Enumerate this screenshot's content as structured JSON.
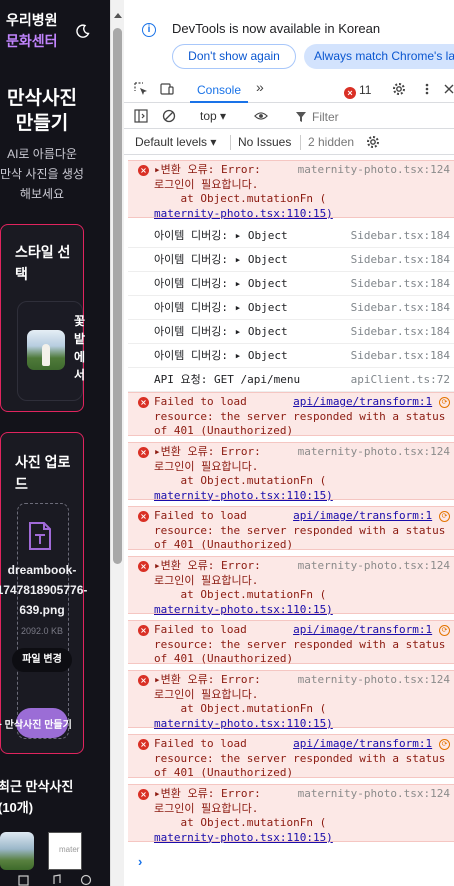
{
  "app": {
    "brand_line1": "우리병원",
    "brand_line2": "문화센터",
    "hero_title": "만삭사진 만들기",
    "hero_subtitle": "AI로 아름다운 만삭 사진을 생성해보세요",
    "style_section": {
      "title": "스타일 선택",
      "item_label": "꽃밭에서"
    },
    "upload_section": {
      "title": "사진 업로드",
      "file_name": "dreambook-1747818905776-639.png",
      "file_size": "2092.0 KB",
      "change_button": "파일 변경"
    },
    "generate_button": "+ 만삭사진 만들기",
    "recent_title": "최근 만삭사진 (10개)",
    "recent_broken_alt": "mater"
  },
  "devtools": {
    "info_text": "DevTools is now available in Korean",
    "dont_show": "Don't show again",
    "always_match": "Always match Chrome's language",
    "tab_console": "Console",
    "error_count": "11",
    "context": "top",
    "filter_placeholder": "Filter",
    "default_levels": "Default levels ▾",
    "no_issues": "No Issues",
    "hidden": "2 hidden",
    "logs": [
      {
        "type": "err",
        "l1": "▸변환 오류: Error:",
        "src": "maternity-photo.tsx:124",
        "l2": "로그인이 필요합니다.",
        "l3": "    at Object.mutationFn (",
        "l4": "maternity-photo.tsx:110:15)"
      },
      {
        "type": "info",
        "msg": "아이템 디버깅: ▸ Object",
        "src": "Sidebar.tsx:184"
      },
      {
        "type": "info",
        "msg": "아이템 디버깅: ▸ Object",
        "src": "Sidebar.tsx:184"
      },
      {
        "type": "info",
        "msg": "아이템 디버깅: ▸ Object",
        "src": "Sidebar.tsx:184"
      },
      {
        "type": "info",
        "msg": "아이템 디버깅: ▸ Object",
        "src": "Sidebar.tsx:184"
      },
      {
        "type": "info",
        "msg": "아이템 디버깅: ▸ Object",
        "src": "Sidebar.tsx:184"
      },
      {
        "type": "info",
        "msg": "아이템 디버깅: ▸ Object",
        "src": "Sidebar.tsx:184"
      },
      {
        "type": "info",
        "msg": "API 요청: GET /api/menu",
        "src": "apiClient.ts:72"
      },
      {
        "type": "err401",
        "l1": "Failed to load",
        "lnk": "api/image/transform:1",
        "l2": "resource: the server responded with a status",
        "l3": "of 401 (Unauthorized)"
      },
      {
        "type": "err",
        "l1": "▸변환 오류: Error:",
        "src": "maternity-photo.tsx:124",
        "l2": "로그인이 필요합니다.",
        "l3": "    at Object.mutationFn (",
        "l4": "maternity-photo.tsx:110:15)"
      },
      {
        "type": "err401",
        "l1": "Failed to load",
        "lnk": "api/image/transform:1",
        "l2": "resource: the server responded with a status",
        "l3": "of 401 (Unauthorized)"
      },
      {
        "type": "err",
        "l1": "▸변환 오류: Error:",
        "src": "maternity-photo.tsx:124",
        "l2": "로그인이 필요합니다.",
        "l3": "    at Object.mutationFn (",
        "l4": "maternity-photo.tsx:110:15)"
      },
      {
        "type": "err401",
        "l1": "Failed to load",
        "lnk": "api/image/transform:1",
        "l2": "resource: the server responded with a status",
        "l3": "of 401 (Unauthorized)"
      },
      {
        "type": "err",
        "l1": "▸변환 오류: Error:",
        "src": "maternity-photo.tsx:124",
        "l2": "로그인이 필요합니다.",
        "l3": "    at Object.mutationFn (",
        "l4": "maternity-photo.tsx:110:15)"
      },
      {
        "type": "err401",
        "l1": "Failed to load",
        "lnk": "api/image/transform:1",
        "l2": "resource: the server responded with a status",
        "l3": "of 401 (Unauthorized)"
      },
      {
        "type": "err",
        "l1": "▸변환 오류: Error:",
        "src": "maternity-photo.tsx:124",
        "l2": "로그인이 필요합니다.",
        "l3": "    at Object.mutationFn (",
        "l4": "maternity-photo.tsx:110:15)"
      }
    ]
  }
}
